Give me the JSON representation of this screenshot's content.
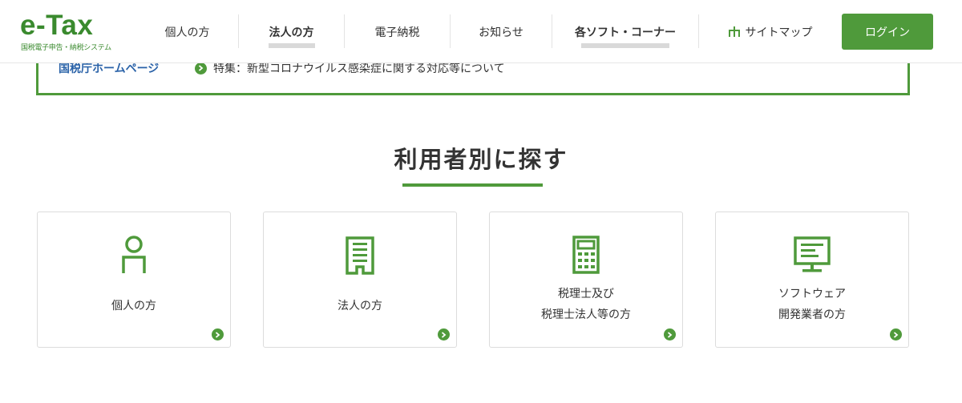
{
  "logo": {
    "main": "e-Tax",
    "sub": "国税電子申告・納税システム"
  },
  "nav": {
    "items": [
      {
        "label": "個人の方"
      },
      {
        "label": "法人の方"
      },
      {
        "label": "電子納税"
      },
      {
        "label": "お知らせ"
      },
      {
        "label": "各ソフト・コーナー"
      },
      {
        "label": "サイトマップ"
      }
    ],
    "login": "ログイン"
  },
  "notice": {
    "label": "国税庁ホームページ",
    "link": "特集：新型コロナウイルス感染症に関する対応等について"
  },
  "section": {
    "title": "利用者別に探す"
  },
  "cards": [
    {
      "line1": "個人の方",
      "line2": ""
    },
    {
      "line1": "法人の方",
      "line2": ""
    },
    {
      "line1": "税理士及び",
      "line2": "税理士法人等の方"
    },
    {
      "line1": "ソフトウェア",
      "line2": "開発業者の方"
    }
  ],
  "colors": {
    "brand_green": "#4f9a3b",
    "link_blue": "#2a62a8"
  },
  "icons": {
    "cards": [
      "person-icon",
      "building-icon",
      "calculator-icon",
      "monitor-icon"
    ],
    "nav": "sitemap-icon",
    "arrow": "chevron-right-circle-icon"
  }
}
